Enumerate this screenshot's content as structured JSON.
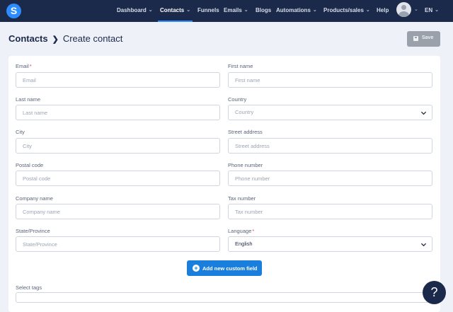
{
  "nav": {
    "logo": "S",
    "items": [
      {
        "label": "Dashboard",
        "chevron": true
      },
      {
        "label": "Contacts",
        "chevron": true,
        "active": true
      },
      {
        "label": "Funnels",
        "chevron": false
      },
      {
        "label": "Emails",
        "chevron": true
      },
      {
        "label": "Blogs",
        "chevron": false
      },
      {
        "label": "Automations",
        "chevron": true
      },
      {
        "label": "Products/sales",
        "chevron": true
      },
      {
        "label": "Help",
        "chevron": false
      }
    ],
    "language": "EN",
    "accent_color": "#2d8cff",
    "background_color": "#1b2a4a"
  },
  "header": {
    "breadcrumb_root": "Contacts",
    "breadcrumb_current": "Create contact",
    "save_label": "Save"
  },
  "form": {
    "email": {
      "label": "Email",
      "required": "*",
      "placeholder": "Email"
    },
    "first_name": {
      "label": "First name",
      "placeholder": "First name"
    },
    "last_name": {
      "label": "Last name",
      "placeholder": "Last name"
    },
    "country": {
      "label": "Country",
      "value": "Country"
    },
    "city": {
      "label": "City",
      "placeholder": "City"
    },
    "street_address": {
      "label": "Street address",
      "placeholder": "Street address"
    },
    "postal_code": {
      "label": "Postal code",
      "placeholder": "Postal code"
    },
    "phone_number": {
      "label": "Phone number",
      "placeholder": "Phone number"
    },
    "company_name": {
      "label": "Company name",
      "placeholder": "Company name"
    },
    "tax_number": {
      "label": "Tax number",
      "placeholder": "Tax number"
    },
    "state_province": {
      "label": "State/Province",
      "placeholder": "State/Province"
    },
    "language": {
      "label": "Language",
      "required": "*",
      "value": "English"
    },
    "add_custom_field_label": "Add new custom field",
    "select_tags_label": "Select tags"
  },
  "help": {
    "icon_label": "?"
  },
  "colors": {
    "primary_button": "#1a7fdc",
    "required_marker": "#e5484d",
    "disabled_button": "#9aa1ab"
  }
}
